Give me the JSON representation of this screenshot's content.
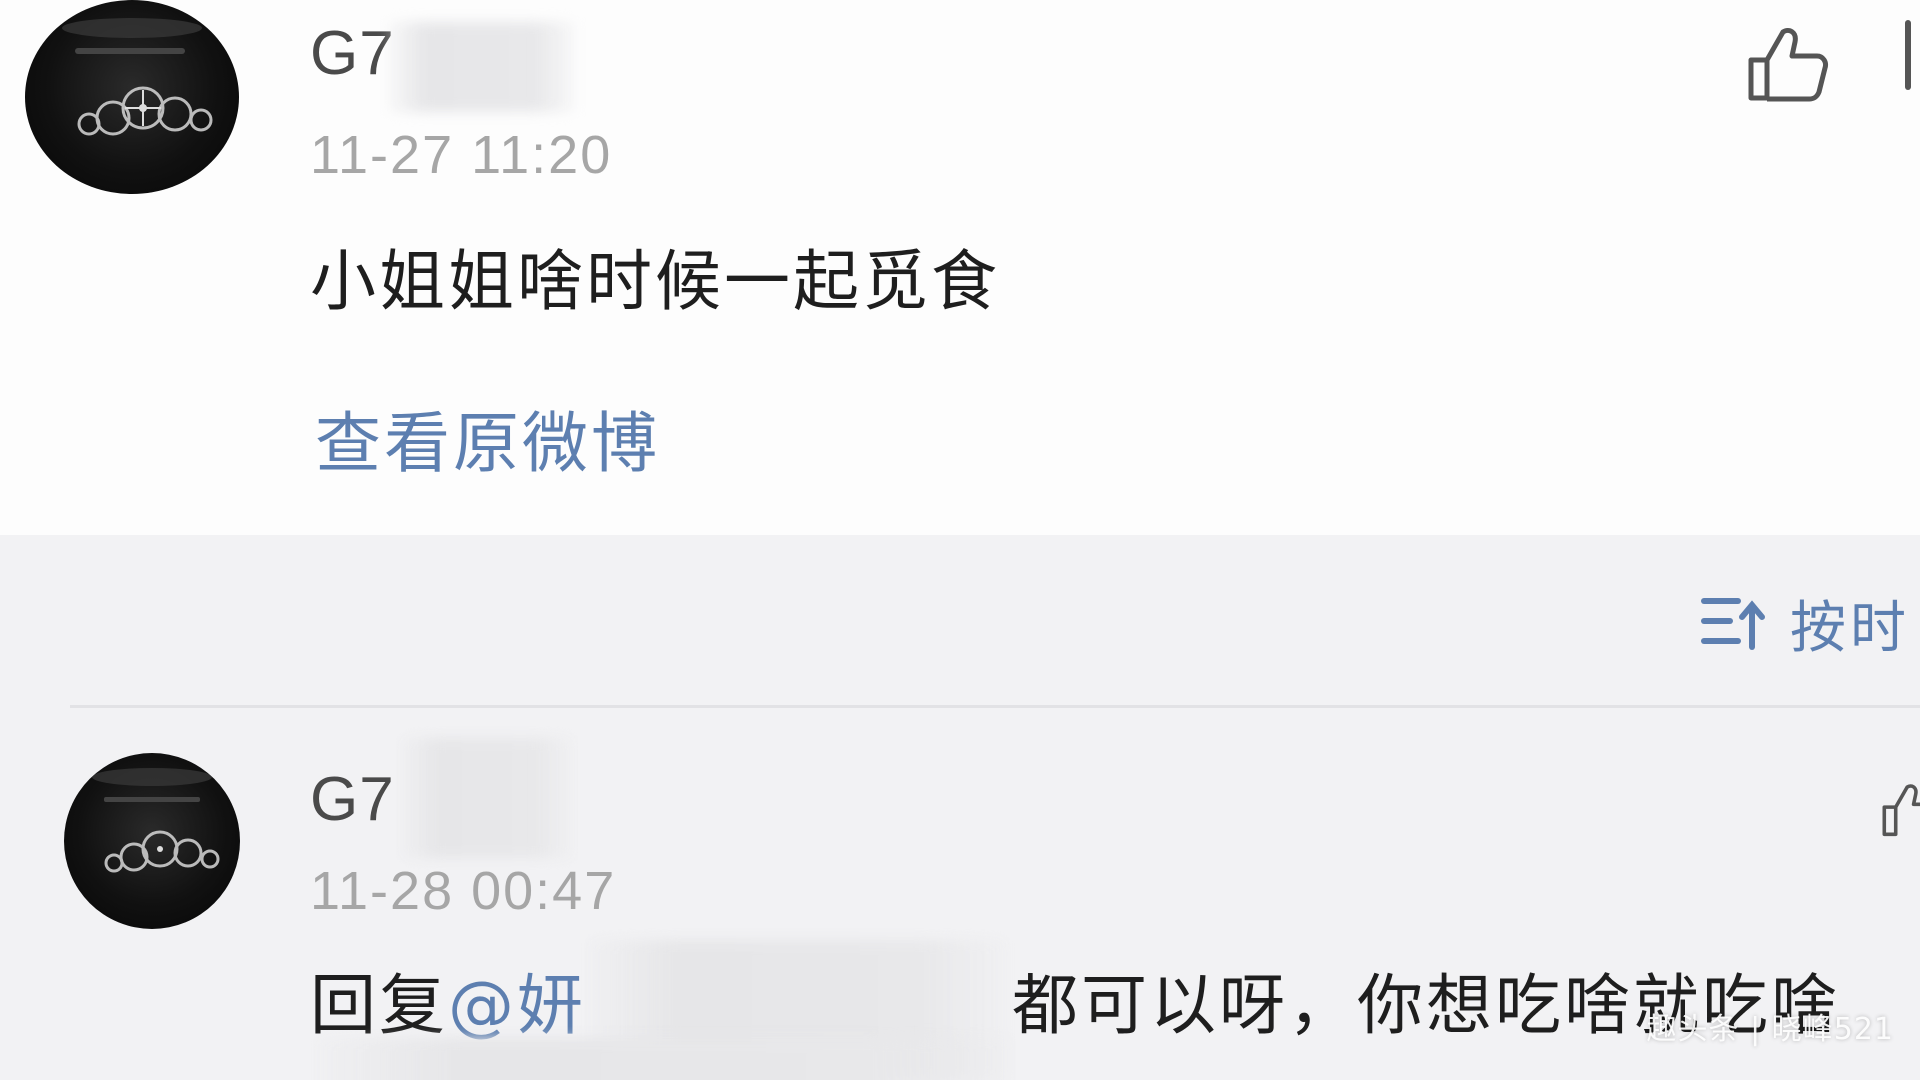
{
  "main_comment": {
    "username": "G7",
    "timestamp": "11-27 11:20",
    "text": "小姐姐啥时候一起觅食",
    "view_original_label": "查看原微博",
    "like_icon": "thumbs-up-icon",
    "avatar_icon": "car-dashboard-avatar"
  },
  "sort_bar": {
    "label": "按时",
    "icon": "sort-up-icon"
  },
  "reply": {
    "username": "G7",
    "timestamp": "11-28 00:47",
    "reply_prefix": "回复",
    "mention": "@妍",
    "text": "都可以呀，你想吃啥就吃啥",
    "like_icon": "thumbs-up-icon",
    "avatar_icon": "car-dashboard-avatar"
  },
  "watermark": "趣头条 | 晓峰521",
  "colors": {
    "link_blue": "#5d7fb0",
    "text_dark": "#1e1e1e",
    "timestamp_gray": "#a6a6a6",
    "card_bg": "#fdfdfd",
    "page_bg": "#f2f2f4"
  }
}
